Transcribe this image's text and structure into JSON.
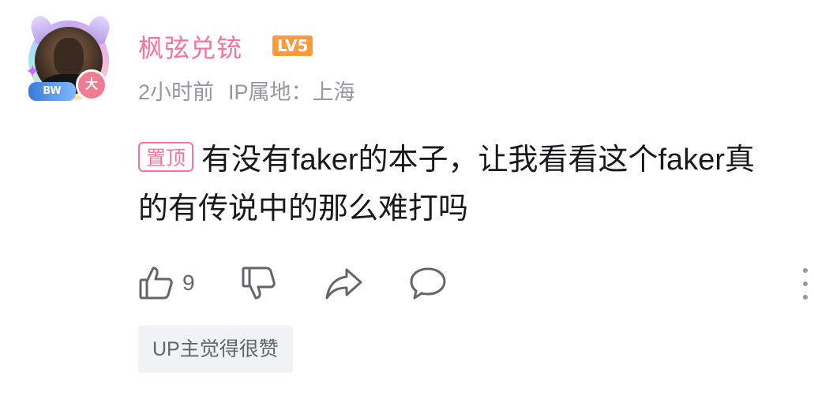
{
  "comment": {
    "author": {
      "name": "枫弦兑铳",
      "level": "LV5",
      "avatar_badge": "BW",
      "avatar_mark": "大"
    },
    "meta": {
      "time": "2小时前",
      "ip_location": "IP属地：上海"
    },
    "pin_label": "置顶",
    "text": "有没有faker的本子，让我看看这个faker真的有传说中的那么难打吗",
    "actions": {
      "like_count": "9",
      "like_icon": "thumbs-up-icon",
      "dislike_icon": "thumbs-down-icon",
      "share_icon": "share-icon",
      "reply_icon": "comment-icon",
      "more_icon": "more-vertical-icon"
    },
    "up_liked_label": "UP主觉得很赞"
  },
  "colors": {
    "accent_pink": "#fb7299",
    "level_orange": "#ff9a3a",
    "meta_gray": "#9499a0",
    "icon_gray": "#61666d",
    "tag_bg": "#f1f2f3"
  }
}
